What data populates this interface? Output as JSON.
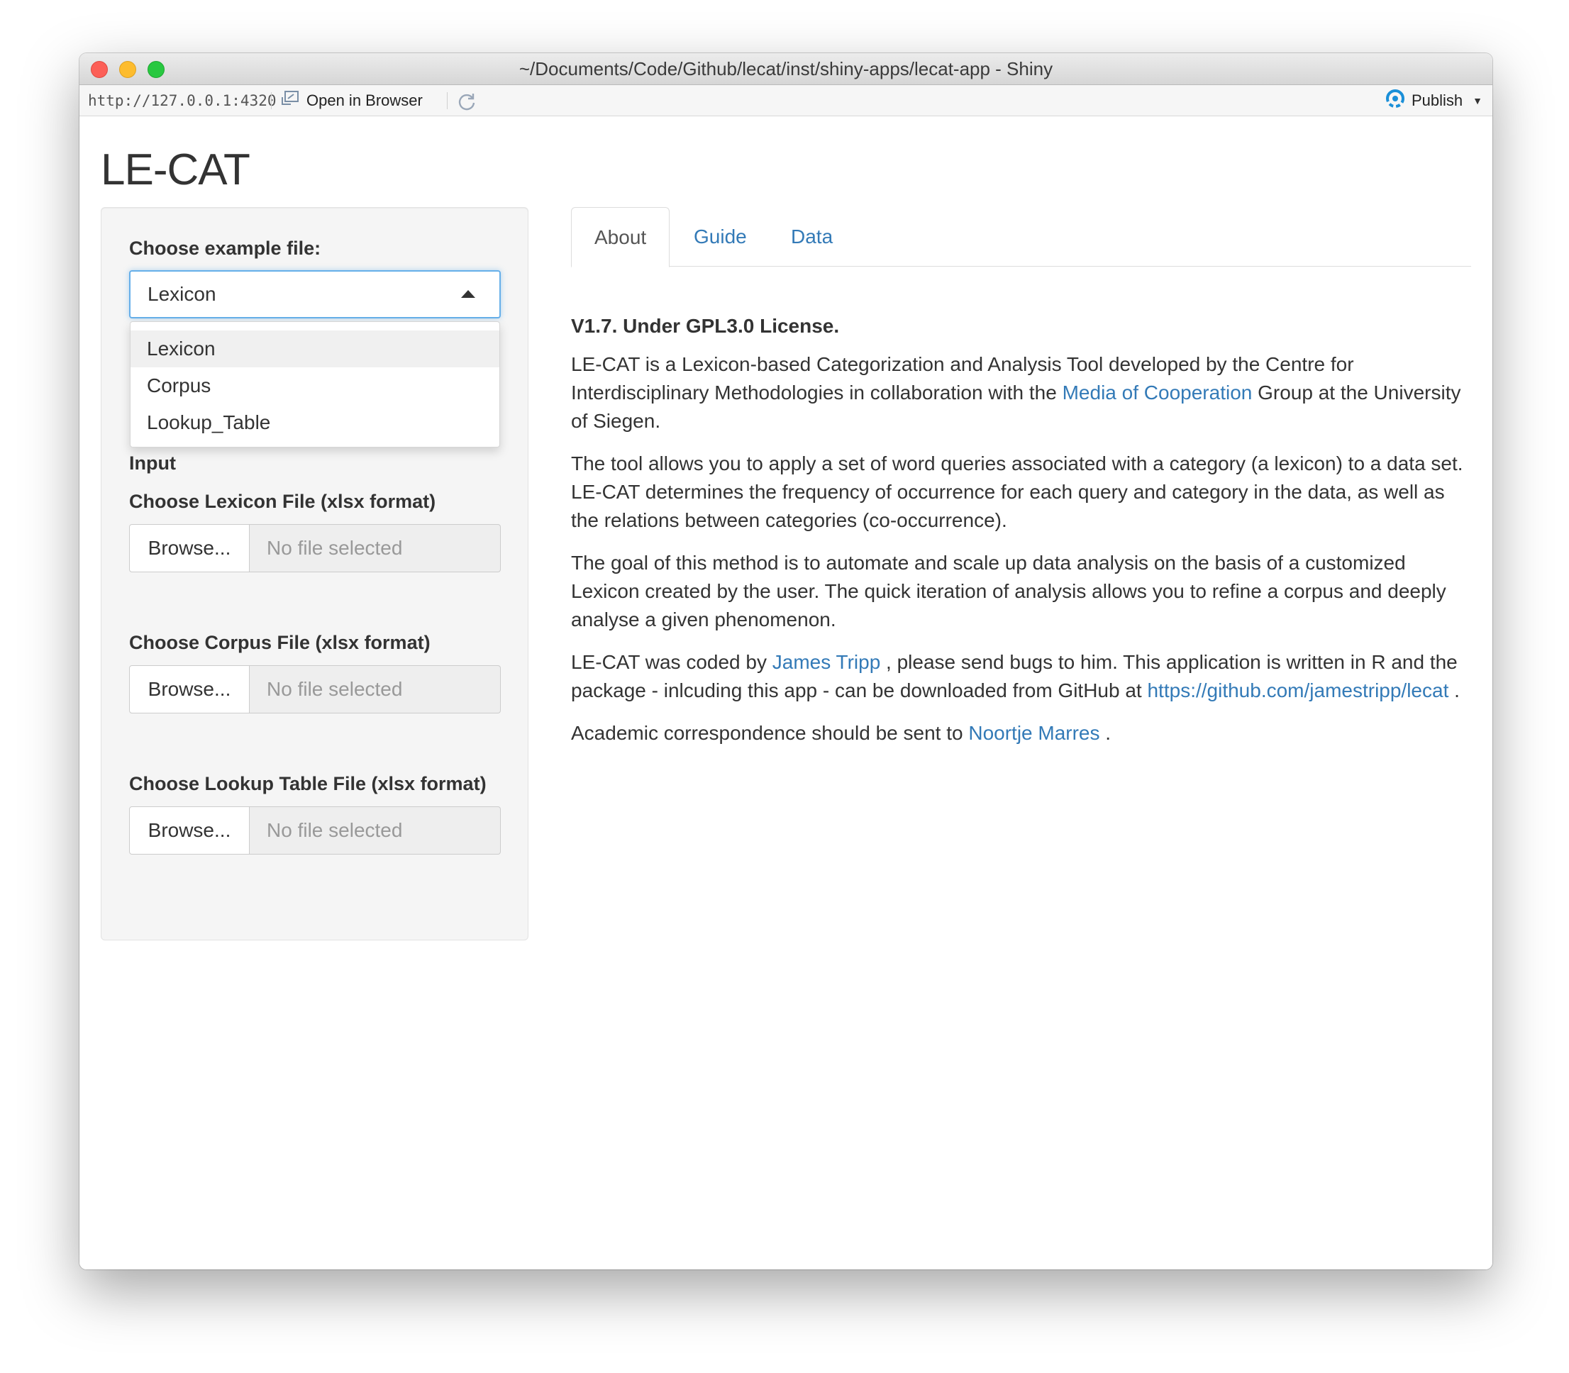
{
  "window": {
    "title": "~/Documents/Code/Github/lecat/inst/shiny-apps/lecat-app - Shiny"
  },
  "toolbar": {
    "url": "http://127.0.0.1:4320",
    "open_in_browser": "Open in Browser",
    "publish": "Publish"
  },
  "app": {
    "title": "LE-CAT"
  },
  "sidebar": {
    "example_label": "Choose example file:",
    "example_selected": "Lexicon",
    "example_options": [
      "Lexicon",
      "Corpus",
      "Lookup_Table"
    ],
    "input_label": "Input",
    "files": [
      {
        "label": "Choose Lexicon File (xlsx format)",
        "button": "Browse...",
        "placeholder": "No file selected"
      },
      {
        "label": "Choose Corpus File (xlsx format)",
        "button": "Browse...",
        "placeholder": "No file selected"
      },
      {
        "label": "Choose Lookup Table File (xlsx format)",
        "button": "Browse...",
        "placeholder": "No file selected"
      }
    ]
  },
  "tabs": [
    {
      "label": "About",
      "active": true
    },
    {
      "label": "Guide",
      "active": false
    },
    {
      "label": "Data",
      "active": false
    }
  ],
  "about": {
    "version": "V1.7. Under GPL3.0 License.",
    "p1_a": "LE-CAT is a Lexicon-based Categorization and Analysis Tool developed by the Centre for Interdisciplinary Methodologies in collaboration with the ",
    "p1_link": "Media of Cooperation",
    "p1_b": " Group at the University of Siegen.",
    "p2": "The tool allows you to apply a set of word queries associated with a category (a lexicon) to a data set. LE-CAT determines the frequency of occurrence for each query and category in the data, as well as the relations between categories (co-occurrence).",
    "p3": "The goal of this method is to automate and scale up data analysis on the basis of a customized Lexicon created by the user. The quick iteration of analysis allows you to refine a corpus and deeply analyse a given phenomenon.",
    "p4_a": "LE-CAT was coded by ",
    "p4_link1": "James Tripp",
    "p4_b": " , please send bugs to him. This application is written in R and the package - inlcuding this app - can be downloaded from GitHub at ",
    "p4_link2": "https://github.com/jamestripp/lecat",
    "p4_c": " .",
    "p5_a": "Academic correspondence should be sent to ",
    "p5_link": "Noortje Marres",
    "p5_b": " ."
  },
  "colors": {
    "link": "#337ab7",
    "focus": "#66afe9",
    "publish_icon": "#1a8fd8"
  }
}
